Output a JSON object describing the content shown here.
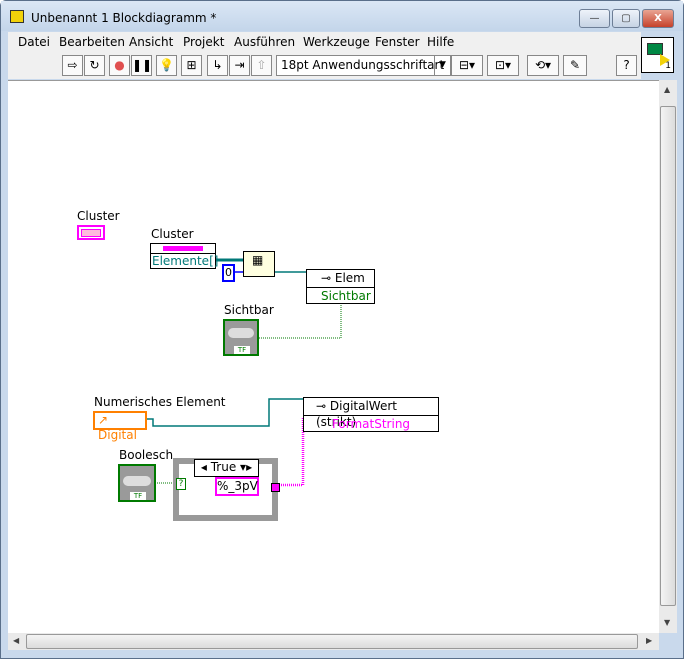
{
  "window": {
    "title": "Unbenannt 1 Blockdiagramm *",
    "minimize": "—",
    "restore": "▢",
    "close": "X"
  },
  "menu": [
    "Datei",
    "Bearbeiten",
    "Ansicht",
    "Projekt",
    "Ausführen",
    "Werkzeuge",
    "Fenster",
    "Hilfe"
  ],
  "toolbar": {
    "font": "18pt Anwendungsschriftart",
    "help": "?"
  },
  "vi_icon": {
    "number": "1"
  },
  "diagram": {
    "cluster_const_label": "Cluster",
    "cluster_node_label": "Cluster",
    "cluster_node_item": "Elemente[]",
    "index_const": "0",
    "prop_node1_class": "Elem",
    "prop_node1_prop": "Sichtbar",
    "sichtbar_label": "Sichtbar",
    "tf": "TF",
    "num_label": "Numerisches Element",
    "num_ref": "Digital",
    "prop_node2_class": "DigitalWert (strikt)",
    "prop_node2_prop": "FormatString",
    "bool_label": "Boolesch",
    "case_selector": "True",
    "string_const": "%_3pV",
    "case_terminal": "?"
  },
  "colors": {
    "cluster": "#ff00ff",
    "numeric": "#ff8000",
    "bool": "#007a00",
    "ref": "#007878",
    "index": "#0000ff"
  }
}
